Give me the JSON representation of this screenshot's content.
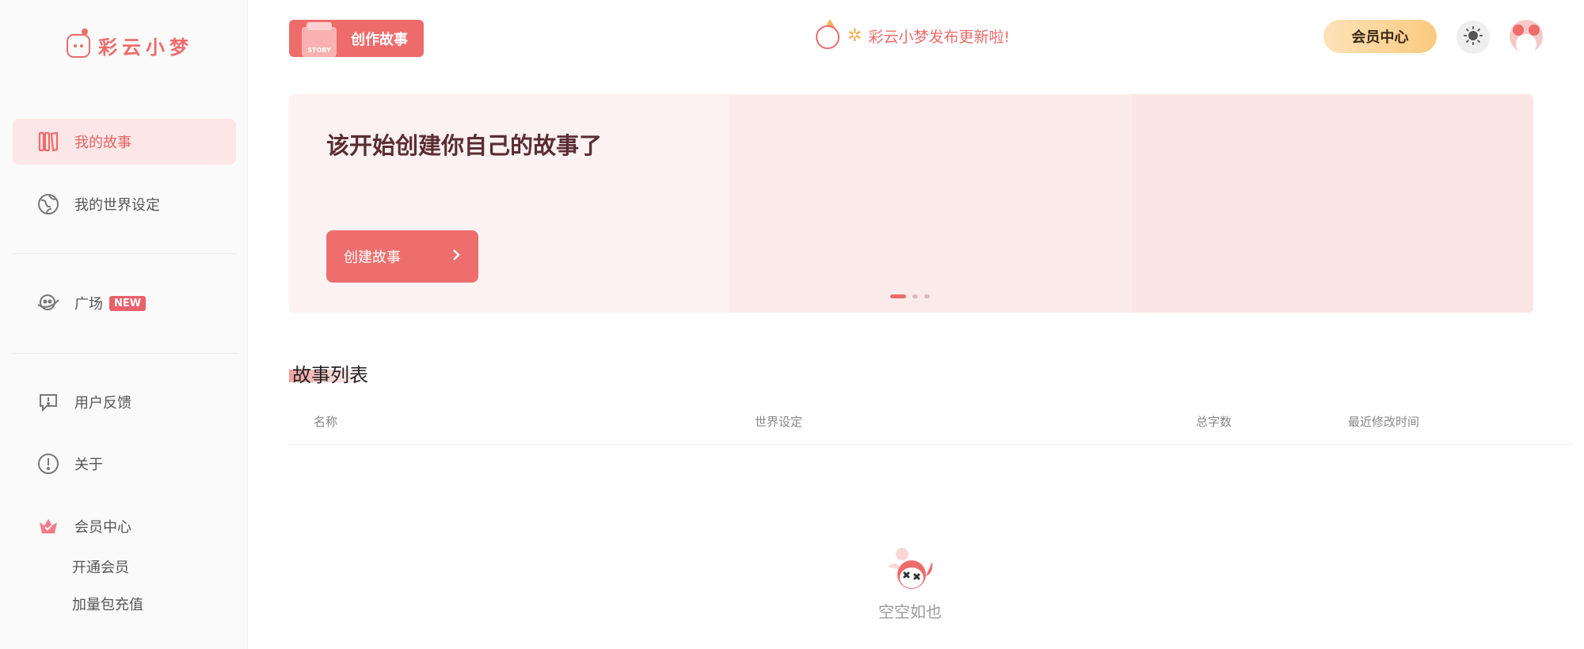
{
  "app": {
    "logo_text": "彩云小梦"
  },
  "sidebar": {
    "items": [
      {
        "label": "我的故事",
        "icon": "books-icon"
      },
      {
        "label": "我的世界设定",
        "icon": "globe-icon"
      },
      {
        "label": "广场",
        "icon": "plaza-icon",
        "badge": "NEW"
      },
      {
        "label": "用户反馈",
        "icon": "feedback-icon"
      },
      {
        "label": "关于",
        "icon": "info-icon"
      },
      {
        "label": "会员中心",
        "icon": "crown-icon"
      }
    ],
    "sub_items": [
      "开通会员",
      "加量包充值"
    ]
  },
  "header": {
    "create_story_label": "创作故事",
    "create_story_box_text": "STORY",
    "announcement": "彩云小梦发布更新啦!",
    "vip_label": "会员中心"
  },
  "banner": {
    "title": "该开始创建你自己的故事了",
    "button_label": "创建故事",
    "slide_count": 3,
    "active_slide": 1
  },
  "story_list": {
    "title": "故事列表",
    "columns": [
      "名称",
      "世界设定",
      "总字数",
      "最近修改时间"
    ],
    "rows": [],
    "empty_text": "空空如也"
  },
  "colors": {
    "accent": "#ee6b6b",
    "vip_gradient_start": "#fde2b8",
    "vip_gradient_end": "#fbca80"
  }
}
